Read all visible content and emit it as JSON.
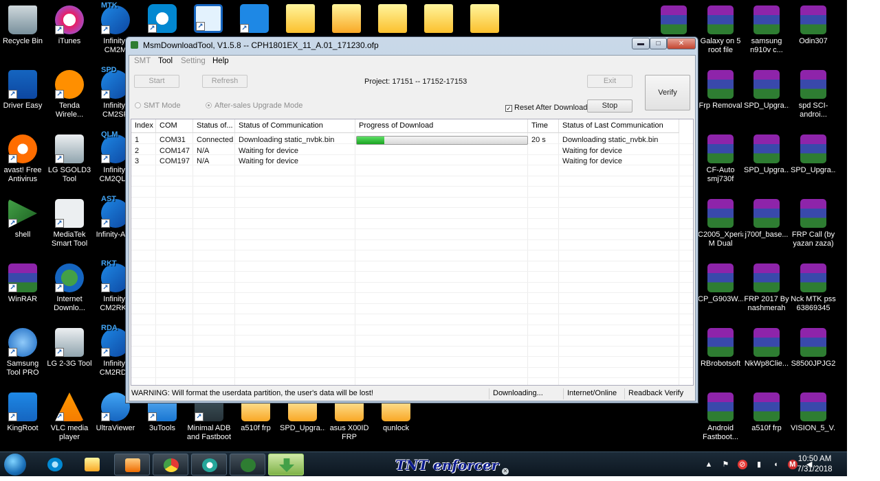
{
  "window": {
    "title": "MsmDownloadTool, V1.5.8 -- CPH1801EX_11_A.01_171230.ofp",
    "min_glyph": "▬",
    "max_glyph": "□",
    "close_glyph": "✕"
  },
  "menu": {
    "smt": "SMT",
    "tool": "Tool",
    "setting": "Setting",
    "help": "Help"
  },
  "controls": {
    "start": "Start",
    "refresh": "Refresh",
    "project": "Project: 17151 -- 17152-17153",
    "exit": "Exit",
    "verify": "Verify",
    "stop": "Stop",
    "smt_mode": "SMT Mode",
    "aftersales_mode": "After-sales Upgrade Mode",
    "reset_after_download": "Reset After Download",
    "reset_checked_glyph": "✓"
  },
  "grid": {
    "headers": [
      "Index",
      "COM",
      "Status of...",
      "Status of Communication",
      "Progress of Download",
      "Time",
      "Status of Last Communication"
    ],
    "rows": [
      {
        "index": "1",
        "com": "COM31",
        "status": "Connected",
        "comm": "Downloading static_nvbk.bin",
        "progress": 0.16,
        "time": "20 s",
        "last": "Downloading static_nvbk.bin"
      },
      {
        "index": "2",
        "com": "COM147",
        "status": "N/A",
        "comm": "Waiting for device",
        "progress": null,
        "time": "",
        "last": "Waiting for device"
      },
      {
        "index": "3",
        "com": "COM197",
        "status": "N/A",
        "comm": "Waiting for device",
        "progress": null,
        "time": "",
        "last": "Waiting for device"
      }
    ]
  },
  "statusbar": {
    "warning": "WARNING: Will format the userdata partition, the user's data will be lost!",
    "state": "Downloading...",
    "network": "Internet/Online",
    "readback": "Readback Verify"
  },
  "desktop_left": [
    {
      "label": "Recycle Bin",
      "icon": "recycle"
    },
    {
      "label": "iTunes",
      "icon": "itunes"
    },
    {
      "label": "Infinity-CM2M",
      "icon": "infinity",
      "badge": "MTK"
    },
    {
      "label": "Driver Easy",
      "icon": "driver"
    },
    {
      "label": "Tenda Wirele...",
      "icon": "tenda"
    },
    {
      "label": "Infinity-CM2SP",
      "icon": "infinity",
      "badge": "SPD"
    },
    {
      "label": "avast! Free Antivirus",
      "icon": "avast"
    },
    {
      "label": "LG SGOLD3 Tool",
      "icon": "lg"
    },
    {
      "label": "Infinity-CM2QLM",
      "icon": "infinity",
      "badge": "QLM"
    },
    {
      "label": "shell",
      "icon": "shell"
    },
    {
      "label": "MediaTek Smart Tool",
      "icon": "mediatek"
    },
    {
      "label": "Infinity-AST",
      "icon": "infinity",
      "badge": "AST"
    },
    {
      "label": "WinRAR",
      "icon": "winrar"
    },
    {
      "label": "Internet Downlo...",
      "icon": "idm"
    },
    {
      "label": "Infinity-CM2RKT",
      "icon": "infinity",
      "badge": "RKT"
    },
    {
      "label": "Samsung Tool PRO",
      "icon": "samsung"
    },
    {
      "label": "LG 2-3G Tool",
      "icon": "lg"
    },
    {
      "label": "Infinity-CM2RDA",
      "icon": "infinity",
      "badge": "RDA"
    },
    {
      "label": "KingRoot",
      "icon": "kingroot"
    },
    {
      "label": "VLC media player",
      "icon": "vlc"
    },
    {
      "label": "UltraViewer",
      "icon": "ultra"
    }
  ],
  "desktop_bottom": [
    {
      "label": "3uTools",
      "icon": "utools"
    },
    {
      "label": "Minimal ADB and Fastboot",
      "icon": "adb"
    },
    {
      "label": "a510f frp",
      "icon": "zipfolder"
    },
    {
      "label": "SPD_Upgra...",
      "icon": "zipfolder"
    },
    {
      "label": "asus X00ID FRP",
      "icon": "zipfolder"
    },
    {
      "label": "qunlock",
      "icon": "zipfolder"
    }
  ],
  "desktop_top": [
    {
      "icon": "unlock"
    },
    {
      "icon": "maze"
    },
    {
      "icon": "anchor"
    },
    {
      "icon": "folder"
    },
    {
      "icon": "toolfolder"
    },
    {
      "icon": "folder"
    },
    {
      "icon": "folder"
    },
    {
      "icon": "folder"
    }
  ],
  "desktop_right": [
    {
      "label": "",
      "icon": "winrarR"
    },
    {
      "label": "Galaxy on 5 root file",
      "icon": "winrarR"
    },
    {
      "label": "samsung n910v c...",
      "icon": "winrarR"
    },
    {
      "label": "Odin307",
      "icon": "winrarR"
    },
    {
      "label": "Frp Removal",
      "icon": "winrarR"
    },
    {
      "label": "SPD_Upgra...",
      "icon": "winrarR"
    },
    {
      "label": "spd SCI-androi...",
      "icon": "winrarR"
    },
    {
      "label": "CF-Auto smj730f",
      "icon": "winrarR"
    },
    {
      "label": "SPD_Upgra...",
      "icon": "winrarR"
    },
    {
      "label": "SPD_Upgra...",
      "icon": "winrarR"
    },
    {
      "label": "C2005_Xperia M Dual",
      "icon": "winrarR"
    },
    {
      "label": "j700f_base...",
      "icon": "winrarR"
    },
    {
      "label": "FRP Call (by yazan zaza)",
      "icon": "winrarR"
    },
    {
      "label": "CP_G903W...",
      "icon": "winrarR"
    },
    {
      "label": "FRP 2017 By nashmerah",
      "icon": "winrarR"
    },
    {
      "label": "Nck MTK pss 63869345",
      "icon": "winrarR"
    },
    {
      "label": "RBrobotsoft",
      "icon": "winrarR"
    },
    {
      "label": "NkWp8Clie...",
      "icon": "winrarR"
    },
    {
      "label": "S8500JPJG2",
      "icon": "winrarR"
    },
    {
      "label": "Android Fastboot...",
      "icon": "winrarR"
    },
    {
      "label": "a510f frp",
      "icon": "winrarR"
    },
    {
      "label": "VISION_5_V...",
      "icon": "winrarR"
    }
  ],
  "taskbar": {
    "watermark": "TNT enforcer",
    "wm_close": "✕",
    "tray_glyphs": [
      "▲",
      "⚑",
      "⊘",
      "▮",
      "◖",
      "M",
      "◀"
    ],
    "time": "10:50 AM",
    "date": "7/31/2018"
  },
  "colors": {
    "progress": "#27b22e",
    "desktop": "#000000",
    "window_frame": "#bfcfe0"
  }
}
